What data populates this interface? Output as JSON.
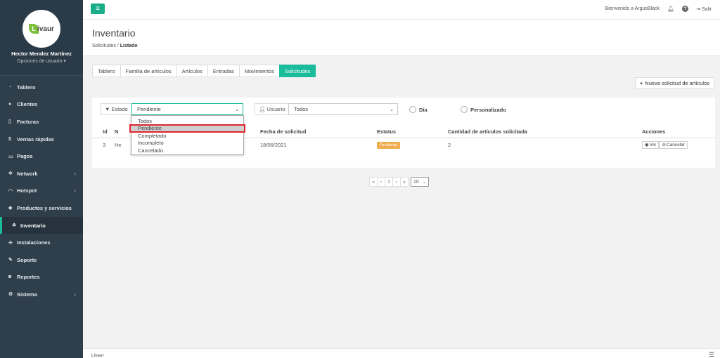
{
  "sidebar": {
    "logo_letter": "L",
    "logo_text": "ivaur",
    "user_name": "Hector Mendez Martínez",
    "user_options": "Opciones de usuario ▾",
    "items": [
      {
        "label": "Tablero",
        "icon": "dashboard-icon",
        "glyph": "◔"
      },
      {
        "label": "Clientes",
        "icon": "users-icon",
        "glyph": "👥"
      },
      {
        "label": "Facturas",
        "icon": "file-icon",
        "glyph": "▯"
      },
      {
        "label": "Ventas rápidas",
        "icon": "dollar-icon",
        "glyph": "$"
      },
      {
        "label": "Pagos",
        "icon": "money-icon",
        "glyph": "▭"
      },
      {
        "label": "Network",
        "icon": "network-icon",
        "glyph": "✲"
      },
      {
        "label": "Hotspot",
        "icon": "wifi-icon",
        "glyph": "◠"
      },
      {
        "label": "Productos y servicios",
        "icon": "tag-icon",
        "glyph": "◆"
      },
      {
        "label": "Inventario",
        "icon": "cubes-icon",
        "glyph": "☘"
      },
      {
        "label": "Instalaciones",
        "icon": "gears-icon",
        "glyph": "✣"
      },
      {
        "label": "Soporte",
        "icon": "wrench-icon",
        "glyph": "✎"
      },
      {
        "label": "Reportes",
        "icon": "report-icon",
        "glyph": "◙"
      },
      {
        "label": "Sistema",
        "icon": "cogs-icon",
        "glyph": "⚙"
      }
    ]
  },
  "topbar": {
    "menu_glyph": "≡",
    "welcome": "Bienvenido a ArgusBlack",
    "logout": "Salir"
  },
  "header": {
    "title": "Inventario",
    "crumb_1": "Solicitudes",
    "crumb_sep": "/",
    "crumb_2": "Listado"
  },
  "tabs": [
    "Tablero",
    "Familia de artículos",
    "Artículos",
    "Entradas",
    "Movimientos",
    "Solicitudes"
  ],
  "new_request_label": "Nueva solicitud de artículos",
  "filters": {
    "estado_label": "Estado",
    "estado_value": "Pendiente",
    "usuario_label": "Usuario",
    "usuario_value": "Todos",
    "radio_dia": "Día",
    "radio_personalizado": "Personalizado"
  },
  "dropdown_options": [
    "Todos",
    "Pendiente",
    "Completado",
    "Incompleto",
    "Cancelado"
  ],
  "table": {
    "headers": [
      "Id",
      "N",
      "Fecha de solicitud",
      "Estatus",
      "Cantidad de artículos solicitada",
      "Acciones"
    ],
    "rows": [
      {
        "id": "3",
        "name": "He",
        "fecha": "18/06/2021",
        "estatus": "Pendiente",
        "cantidad": "2"
      }
    ],
    "view_label": "Ver",
    "cancel_label": "Cancelar"
  },
  "pagination": {
    "first": "«",
    "prev": "‹",
    "page": "1",
    "next": "›",
    "last": "»",
    "page_size": "10"
  },
  "footer": {
    "text": "Livaur"
  },
  "colors": {
    "accent": "#1abc9c",
    "sidebar": "#2f3e4b",
    "badge_pending": "#f0ad4e",
    "highlight": "#e0252b"
  }
}
